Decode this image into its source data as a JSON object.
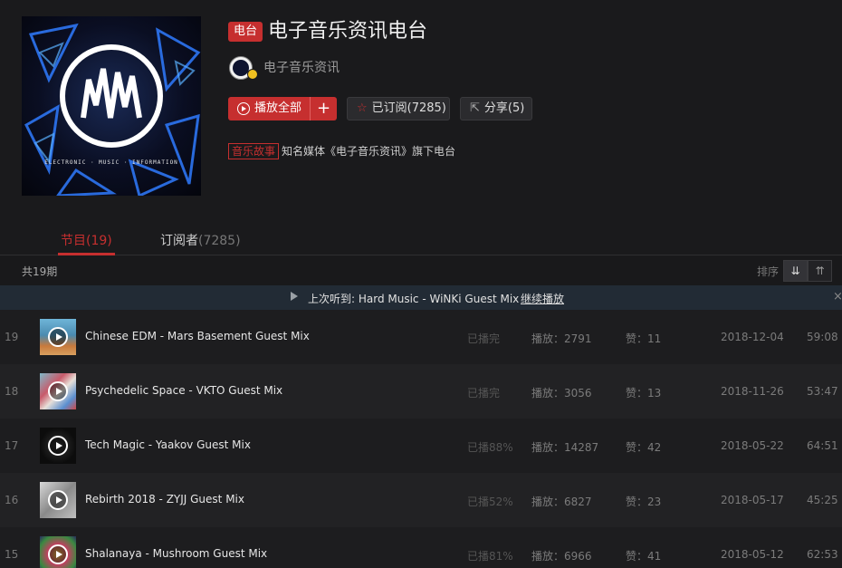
{
  "radio": {
    "badge": "电台",
    "title": "电子音乐资讯电台",
    "cover_caption": "ELECTRONIC · MUSIC · INFORMATION",
    "owner": "电子音乐资讯",
    "tag": "音乐故事",
    "description": "知名媒体《电子音乐资讯》旗下电台"
  },
  "actions": {
    "play_all": "播放全部",
    "add": "+",
    "subscribed": "已订阅(7285)",
    "share": "分享(5)"
  },
  "tabs": {
    "programs_label": "节目",
    "programs_count": "(19)",
    "subscribers_label": "订阅者",
    "subscribers_count": "(7285)"
  },
  "toolbar": {
    "total": "共19期",
    "sort_label": "排序"
  },
  "last_played": {
    "text": "上次听到: Hard Music - WiNKi Guest Mix",
    "continue": "继续播放",
    "close": "×"
  },
  "colors": {
    "accent": "#c62f2f",
    "background": "#1a1a1c"
  },
  "programs": [
    {
      "num": "19",
      "name": "Chinese EDM - Mars Basement Guest Mix",
      "progress": "已播完",
      "plays": "播放：2791",
      "likes": "赞：11",
      "date": "2018-12-04",
      "duration": "59:08",
      "thumb": "linear-gradient(180deg,#6fb5d8 0%,#4a8bb0 45%,#c87a3c 75%,#d8a060 100%)"
    },
    {
      "num": "18",
      "name": "Psychedelic Space - VKTO Guest Mix",
      "progress": "已播完",
      "plays": "播放：3056",
      "likes": "赞：13",
      "date": "2018-11-26",
      "duration": "53:47",
      "thumb": "linear-gradient(135deg,#7fb8c8 0%,#c85a6a 35%,#e8e0d8 55%,#5a8fd0 80%,#d04848 100%)"
    },
    {
      "num": "17",
      "name": "Tech Magic - Yaakov Guest Mix",
      "progress": "已播88%",
      "plays": "播放：14287",
      "likes": "赞：42",
      "date": "2018-05-22",
      "duration": "64:51",
      "thumb": "radial-gradient(circle,#333 0%,#0c0c0c 70%)"
    },
    {
      "num": "16",
      "name": "Rebirth 2018 - ZYJJ Guest Mix",
      "progress": "已播52%",
      "plays": "播放：6827",
      "likes": "赞：23",
      "date": "2018-05-17",
      "duration": "45:25",
      "thumb": "linear-gradient(135deg,#d8d8d8 0%,#8a8a8a 50%,#c0c0c0 100%)"
    },
    {
      "num": "15",
      "name": "Shalanaya - Mushroom Guest Mix",
      "progress": "已播81%",
      "plays": "播放：6966",
      "likes": "赞：41",
      "date": "2018-05-12",
      "duration": "62:53",
      "thumb": "radial-gradient(circle,#e8c040 0%,#c04060 40%,#3a8a40 75%,#2a2a60 100%)"
    }
  ]
}
